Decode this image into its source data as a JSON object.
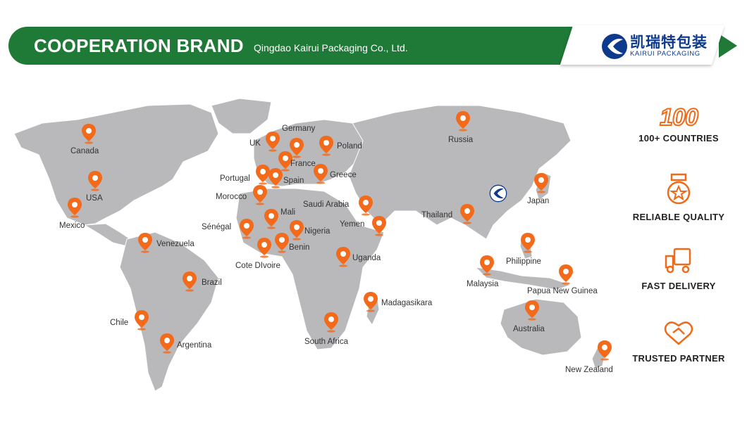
{
  "header": {
    "title": "COOPERATION BRAND",
    "subtitle": "Qingdao Kairui Packaging Co., Ltd.",
    "logo_cn": "凯瑞特包装",
    "logo_en": "KAIRUI PACKAGING"
  },
  "colors": {
    "banner": "#1f7a38",
    "pin": "#f26a1a",
    "land": "#b9b9bb",
    "brand": "#0d3a8c"
  },
  "countries": [
    "Canada",
    "USA",
    "Mexico",
    "Venezuela",
    "Brazil",
    "Chile",
    "Argentina",
    "UK",
    "Germany",
    "Poland",
    "France",
    "Portugal",
    "Spain",
    "Greece",
    "Morocco",
    "Mali",
    "Sénégal",
    "Nigeria",
    "Benin",
    "Cote DIvoire",
    "Saudi Arabia",
    "Yemen",
    "Uganda",
    "Madagasikara",
    "South Africa",
    "Russia",
    "Thailand",
    "Japan",
    "Philippine",
    "Malaysia",
    "Papua New Guinea",
    "Australia",
    "New Zealand"
  ],
  "features": [
    {
      "icon": "100-badge-icon",
      "value": "100",
      "label": "100+ COUNTRIES"
    },
    {
      "icon": "medal-icon",
      "label": "RELIABLE QUALITY"
    },
    {
      "icon": "delivery-truck-icon",
      "label": "FAST DELIVERY"
    },
    {
      "icon": "handshake-icon",
      "label": "TRUSTED PARTNER"
    }
  ]
}
